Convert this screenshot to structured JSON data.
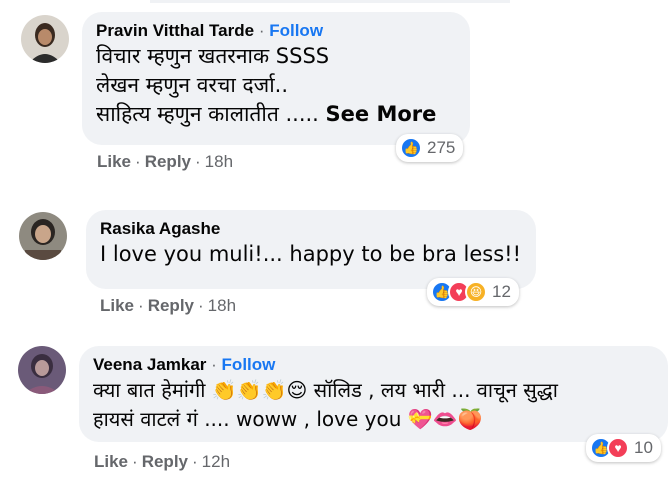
{
  "comments": [
    {
      "author": "Pravin Vitthal Tarde",
      "follow": "Follow",
      "lines": [
        "विचार म्हणुन खतरनाक SSSS",
        "लेखन म्हणुन वरचा दर्जा..",
        "साहित्य म्हणुन कालातीत ....."
      ],
      "see_more": "See More",
      "like": "Like",
      "reply": "Reply",
      "time": "18h",
      "reaction_count": "275",
      "reactions": [
        "like"
      ]
    },
    {
      "author": "Rasika Agashe",
      "lines": [
        "I love you muli!... happy to be bra less!!"
      ],
      "like": "Like",
      "reply": "Reply",
      "time": "18h",
      "reaction_count": "12",
      "reactions": [
        "like",
        "love",
        "haha"
      ]
    },
    {
      "author": "Veena Jamkar",
      "follow": "Follow",
      "lines": [
        "क्या बात हेमांगी 👏👏👏😌 सॉलिड , लय भारी ... वाचून सुद्धा",
        "हायसं वाटलं गं .... woww , love you 💝👄🍑"
      ],
      "like": "Like",
      "reply": "Reply",
      "time": "12h",
      "reaction_count": "10",
      "reactions": [
        "like",
        "love"
      ]
    }
  ],
  "colors": {
    "bubble": "#f0f2f5",
    "follow": "#1877f2",
    "muted": "#65676b",
    "like": "#1877f2",
    "love": "#f33e58",
    "haha": "#f7b125"
  }
}
